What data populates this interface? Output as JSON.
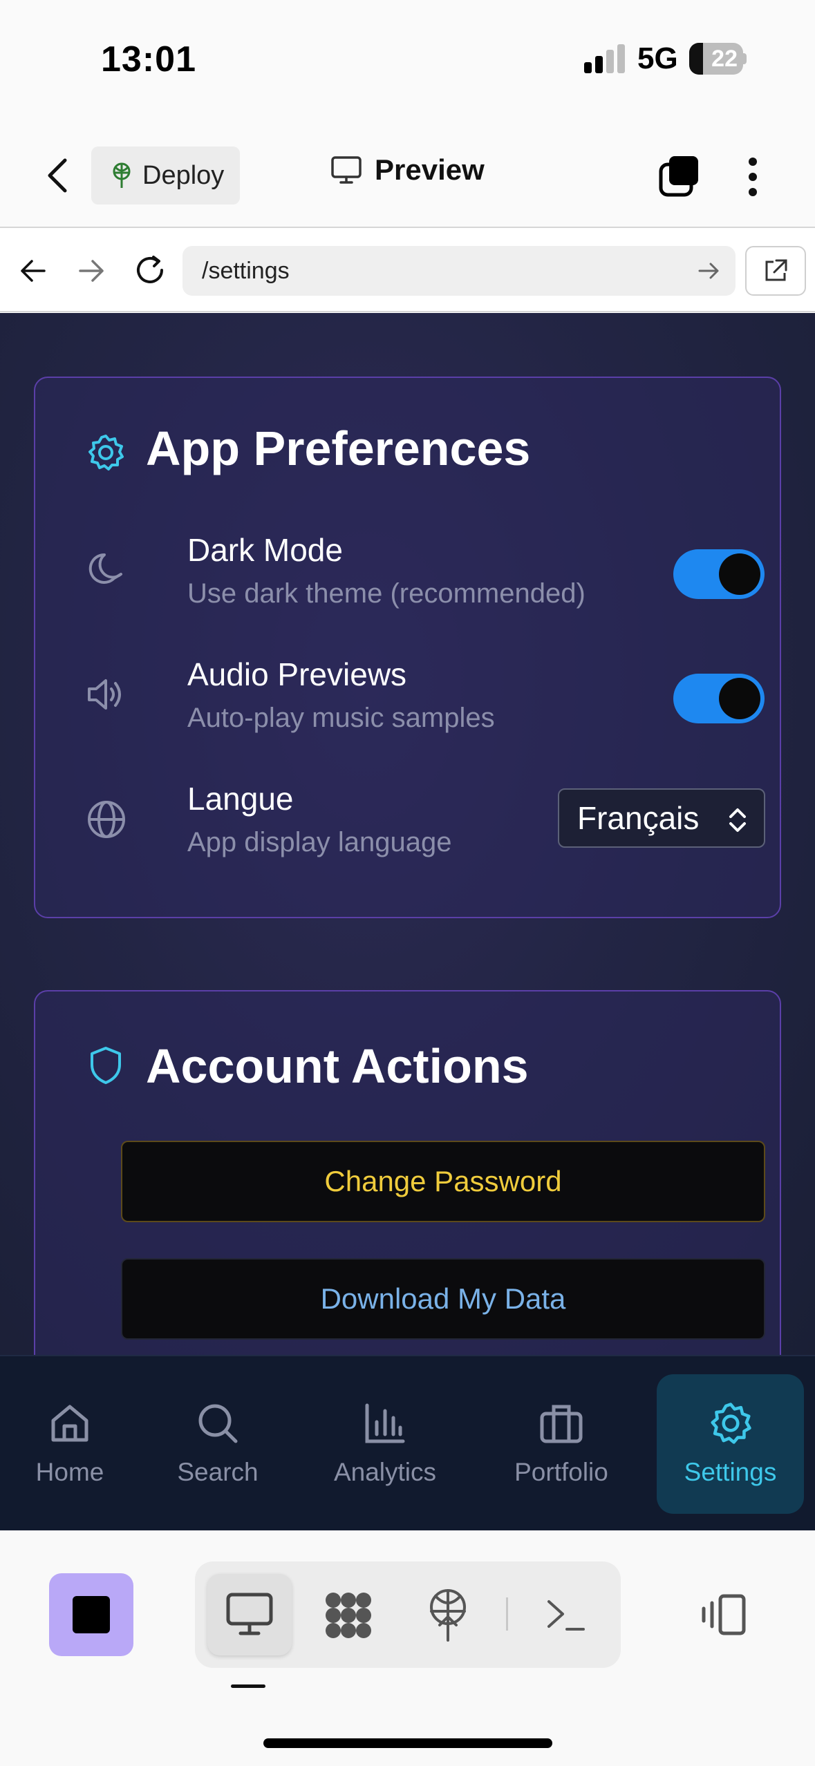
{
  "status_bar": {
    "time": "13:01",
    "network": "5G",
    "battery": "22"
  },
  "header": {
    "deploy_label": "Deploy",
    "preview_label": "Preview"
  },
  "browser": {
    "url": "/settings"
  },
  "preferences": {
    "title": "App Preferences",
    "dark_mode": {
      "title": "Dark Mode",
      "subtitle": "Use dark theme (recommended)",
      "enabled": true
    },
    "audio": {
      "title": "Audio Previews",
      "subtitle": "Auto-play music samples",
      "enabled": true
    },
    "language": {
      "title": "Langue",
      "subtitle": "App display language",
      "value": "Français"
    }
  },
  "account": {
    "title": "Account Actions",
    "change_password": "Change Password",
    "download_data": "Download My Data"
  },
  "nav": {
    "items": [
      {
        "label": "Home",
        "icon": "home-icon"
      },
      {
        "label": "Search",
        "icon": "search-icon"
      },
      {
        "label": "Analytics",
        "icon": "bar-chart-icon"
      },
      {
        "label": "Portfolio",
        "icon": "briefcase-icon"
      },
      {
        "label": "Settings",
        "icon": "gear-icon"
      }
    ],
    "active": "Settings"
  },
  "colors": {
    "accent": "#3ec8ea",
    "toggle": "#1e88f0",
    "card_border": "#5b3fa8",
    "password": "#f0cc3c",
    "download": "#7ab2e8",
    "stop_button": "#b9a8f7"
  }
}
